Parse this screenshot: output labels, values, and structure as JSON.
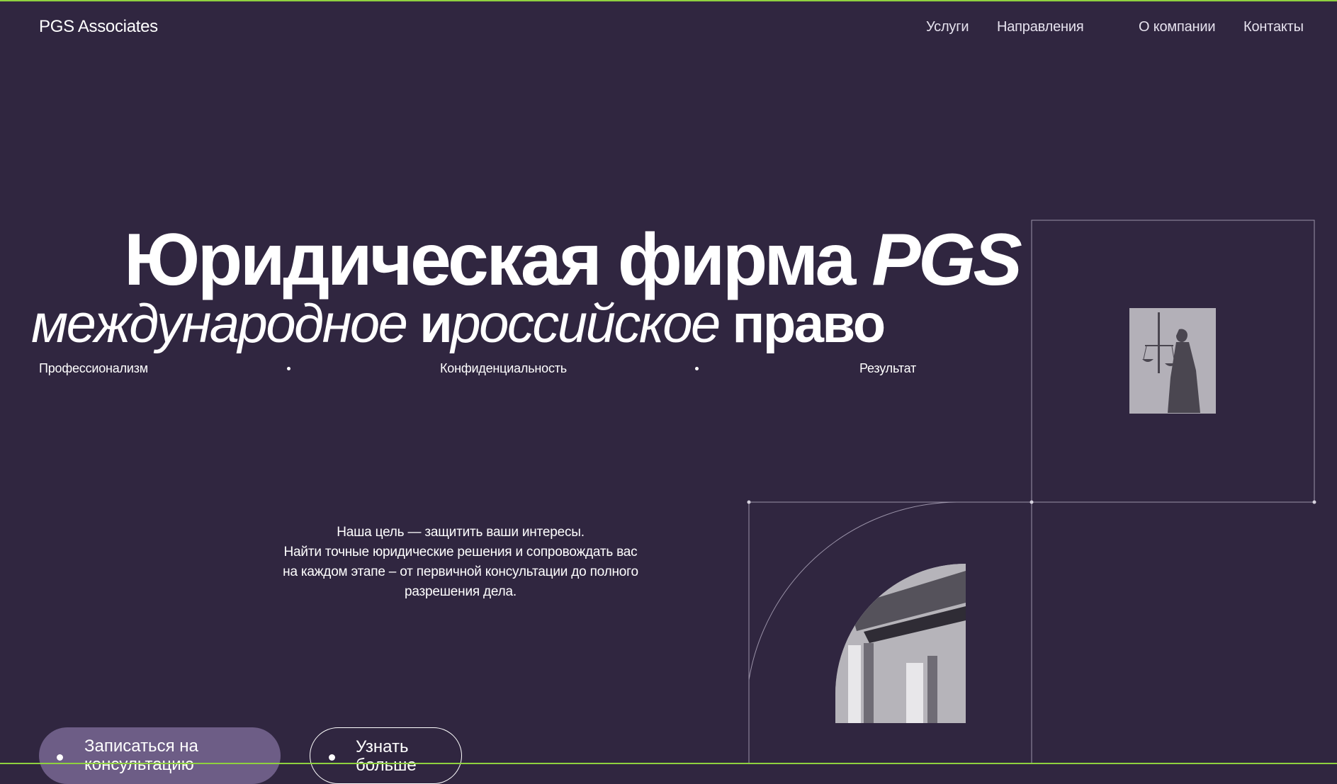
{
  "header": {
    "logo": "PGS Associates",
    "nav": [
      {
        "label": "Услуги"
      },
      {
        "label": "Направления"
      },
      {
        "label": "О компании"
      },
      {
        "label": "Контакты"
      }
    ]
  },
  "hero": {
    "title_main": "Юридическая фирма",
    "title_brand": "PGS",
    "subtitle_part1": "международное",
    "subtitle_and": "и",
    "subtitle_part2": "российское",
    "subtitle_part3": "право",
    "values": [
      "Профессионализм",
      "Конфиденциальность",
      "Результат"
    ],
    "description": {
      "line1": "Наша цель — защитить ваши интересы.",
      "line2": "Найти точные юридические решения и сопровождать вас",
      "line3": "на каждом этапе – от первичной консультации до полного",
      "line4": "разрешения дела."
    },
    "buttons": {
      "primary": "Записаться на консультацию",
      "secondary": "Узнать больше"
    }
  },
  "colors": {
    "background": "#302640",
    "accent": "#8fd13f",
    "button_primary": "#6d5d86"
  },
  "icons": {
    "statue": "lady-justice-statue-photo",
    "building": "courthouse-columns-photo"
  }
}
